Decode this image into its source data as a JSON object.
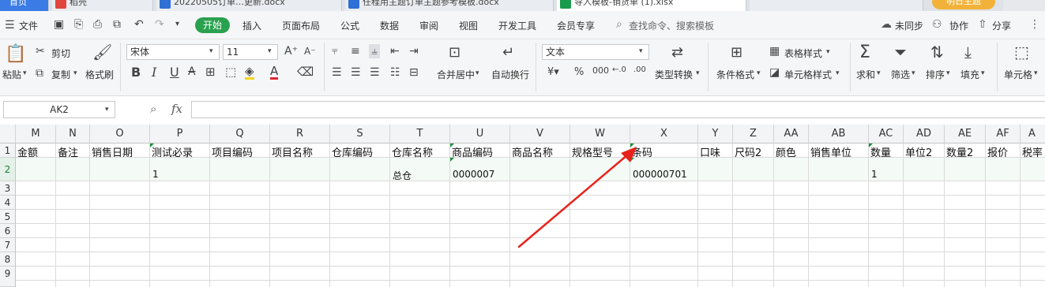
{
  "tabs": [
    {
      "label": "首页",
      "color": "#3a7be6"
    },
    {
      "label": "稻壳",
      "color": "#e0463d"
    },
    {
      "label": "20220505订单…更新.docx",
      "color": "#2f6fd6"
    },
    {
      "label": "任程用主题订单主题参考模板.docx",
      "color": "#2f6fd6"
    },
    {
      "label": "导入模板-销货单 (1).xlsx",
      "color": "#1a9b4c"
    }
  ],
  "tab_user_label": "明日主题",
  "menu": {
    "file": "文件",
    "start": "开始",
    "items": [
      "插入",
      "页面布局",
      "公式",
      "数据",
      "审阅",
      "视图",
      "开发工具",
      "会员专享"
    ],
    "search_placeholder": "查找命令、搜索模板",
    "sync": "未同步",
    "collab": "协作",
    "share": "分享"
  },
  "ribbon": {
    "paste": "粘贴",
    "cut": "剪切",
    "copy": "复制",
    "format_painter": "格式刷",
    "font_name": "宋体",
    "font_size": "11",
    "merge_center": "合并居中",
    "wrap_text": "自动换行",
    "number_format": "文本",
    "convert_type": "类型转换",
    "conditional_format": "条件格式",
    "table_style": "表格样式",
    "cell_style": "单元格样式",
    "sum": "求和",
    "filter": "筛选",
    "sort": "排序",
    "fill": "填充",
    "cell": "单元格"
  },
  "formula_bar": {
    "name_box": "AK2",
    "fx": "fx",
    "value": ""
  },
  "columns": [
    {
      "letter": "M",
      "header": "金额"
    },
    {
      "letter": "N",
      "header": "备注"
    },
    {
      "letter": "O",
      "header": "销售日期"
    },
    {
      "letter": "P",
      "header": "测试必录"
    },
    {
      "letter": "Q",
      "header": "项目编码"
    },
    {
      "letter": "R",
      "header": "项目名称"
    },
    {
      "letter": "S",
      "header": "仓库编码"
    },
    {
      "letter": "T",
      "header": "仓库名称"
    },
    {
      "letter": "U",
      "header": "商品编码"
    },
    {
      "letter": "V",
      "header": "商品名称"
    },
    {
      "letter": "W",
      "header": "规格型号"
    },
    {
      "letter": "X",
      "header": "条码"
    },
    {
      "letter": "Y",
      "header": "口味"
    },
    {
      "letter": "Z",
      "header": "尺码2"
    },
    {
      "letter": "AA",
      "header": "颜色"
    },
    {
      "letter": "AB",
      "header": "销售单位"
    },
    {
      "letter": "AC",
      "header": "数量"
    },
    {
      "letter": "AD",
      "header": "单位2"
    },
    {
      "letter": "AE",
      "header": "数量2"
    },
    {
      "letter": "AF",
      "header": "报价"
    },
    {
      "letter": "A",
      "header": "税率"
    }
  ],
  "row_numbers": [
    "1",
    "2",
    "3",
    "4",
    "5",
    "6",
    "7",
    "8",
    "9"
  ],
  "row2": {
    "P": "1",
    "T": "总仓",
    "U": "0000007",
    "X": "000000701",
    "AC": "1"
  },
  "colors": {
    "accent_green": "#2aa14f",
    "annotation_arrow": "#e8221b",
    "selected_row": "#e6f2ea"
  }
}
